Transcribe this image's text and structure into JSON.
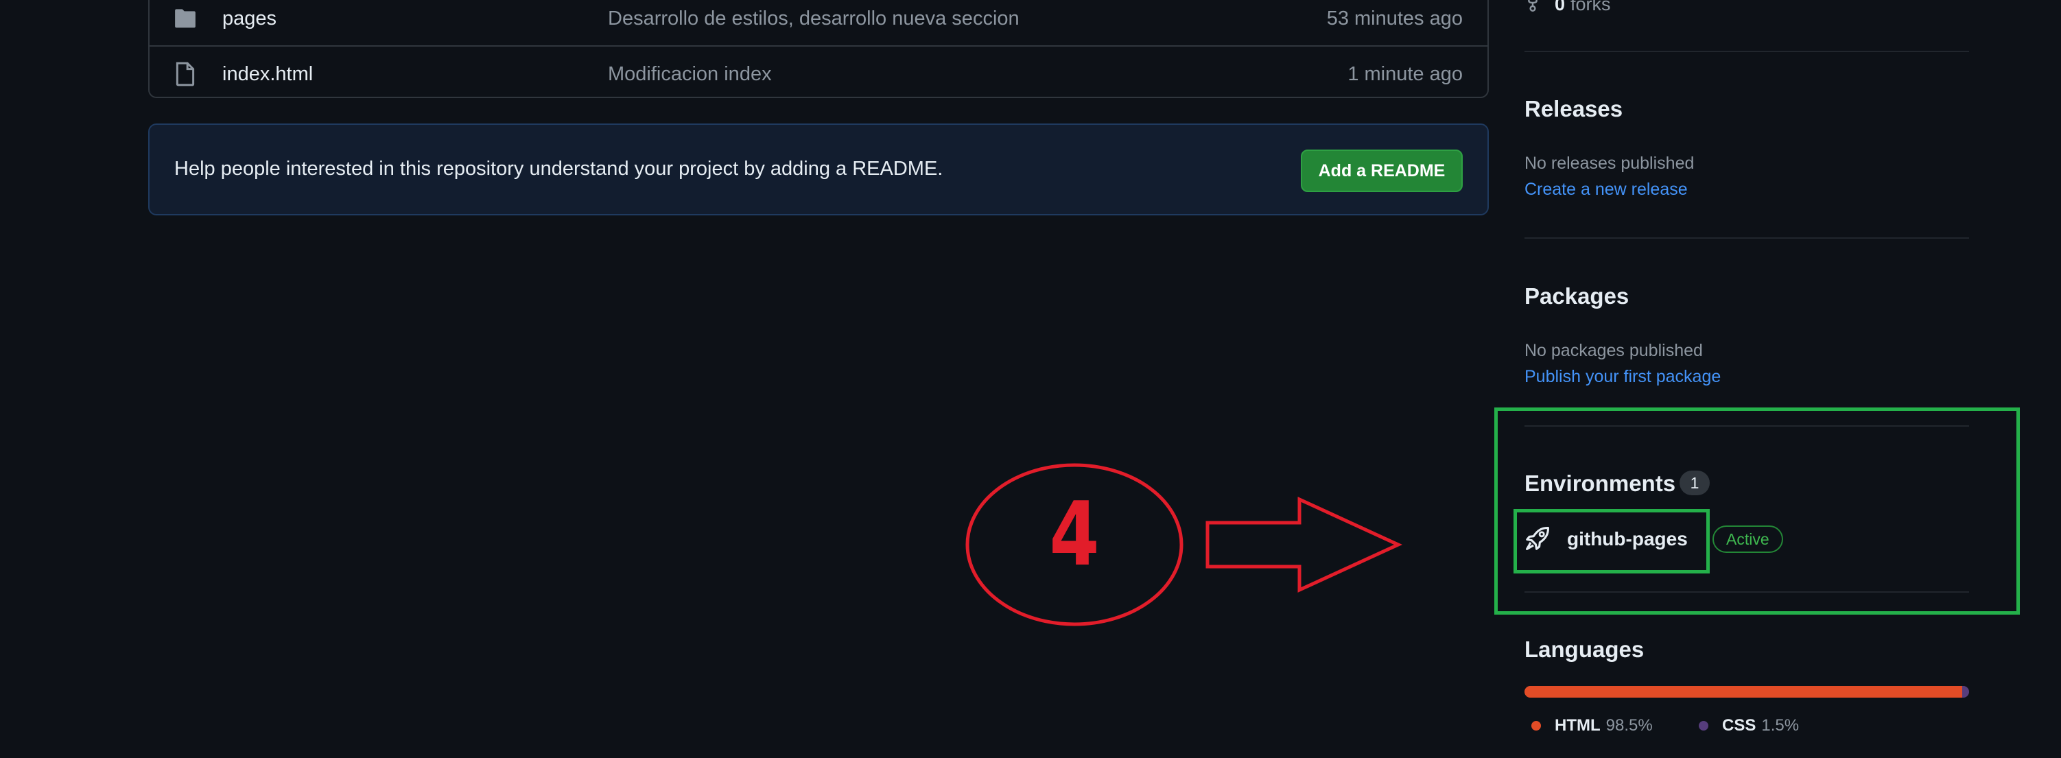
{
  "repo_files": [
    {
      "type": "folder",
      "name": "pages",
      "message": "Desarrollo de estilos, desarrollo nueva seccion",
      "time": "53 minutes ago"
    },
    {
      "type": "file",
      "name": "index.html",
      "message": "Modificacion index",
      "time": "1 minute ago"
    }
  ],
  "readme_banner": {
    "text": "Help people interested in this repository understand your project by adding a README.",
    "button_label": "Add a README"
  },
  "sidebar": {
    "forks": {
      "count": "0",
      "label": "forks"
    },
    "releases": {
      "heading": "Releases",
      "empty_text": "No releases published",
      "link": "Create a new release"
    },
    "packages": {
      "heading": "Packages",
      "empty_text": "No packages published",
      "link": "Publish your first package"
    },
    "environments": {
      "heading": "Environments",
      "count": "1",
      "items": [
        {
          "name": "github-pages",
          "status": "Active",
          "icon": "rocket-icon"
        }
      ]
    },
    "languages": {
      "heading": "Languages",
      "items": [
        {
          "name": "HTML",
          "percent": "98.5%",
          "value": 98.5,
          "color": "#e34c26"
        },
        {
          "name": "CSS",
          "percent": "1.5%",
          "value": 1.5,
          "color": "#563d7c"
        }
      ]
    }
  },
  "annotation": {
    "step_number": "4",
    "color": "#e21d2a",
    "highlight_color": "#24b04a"
  }
}
